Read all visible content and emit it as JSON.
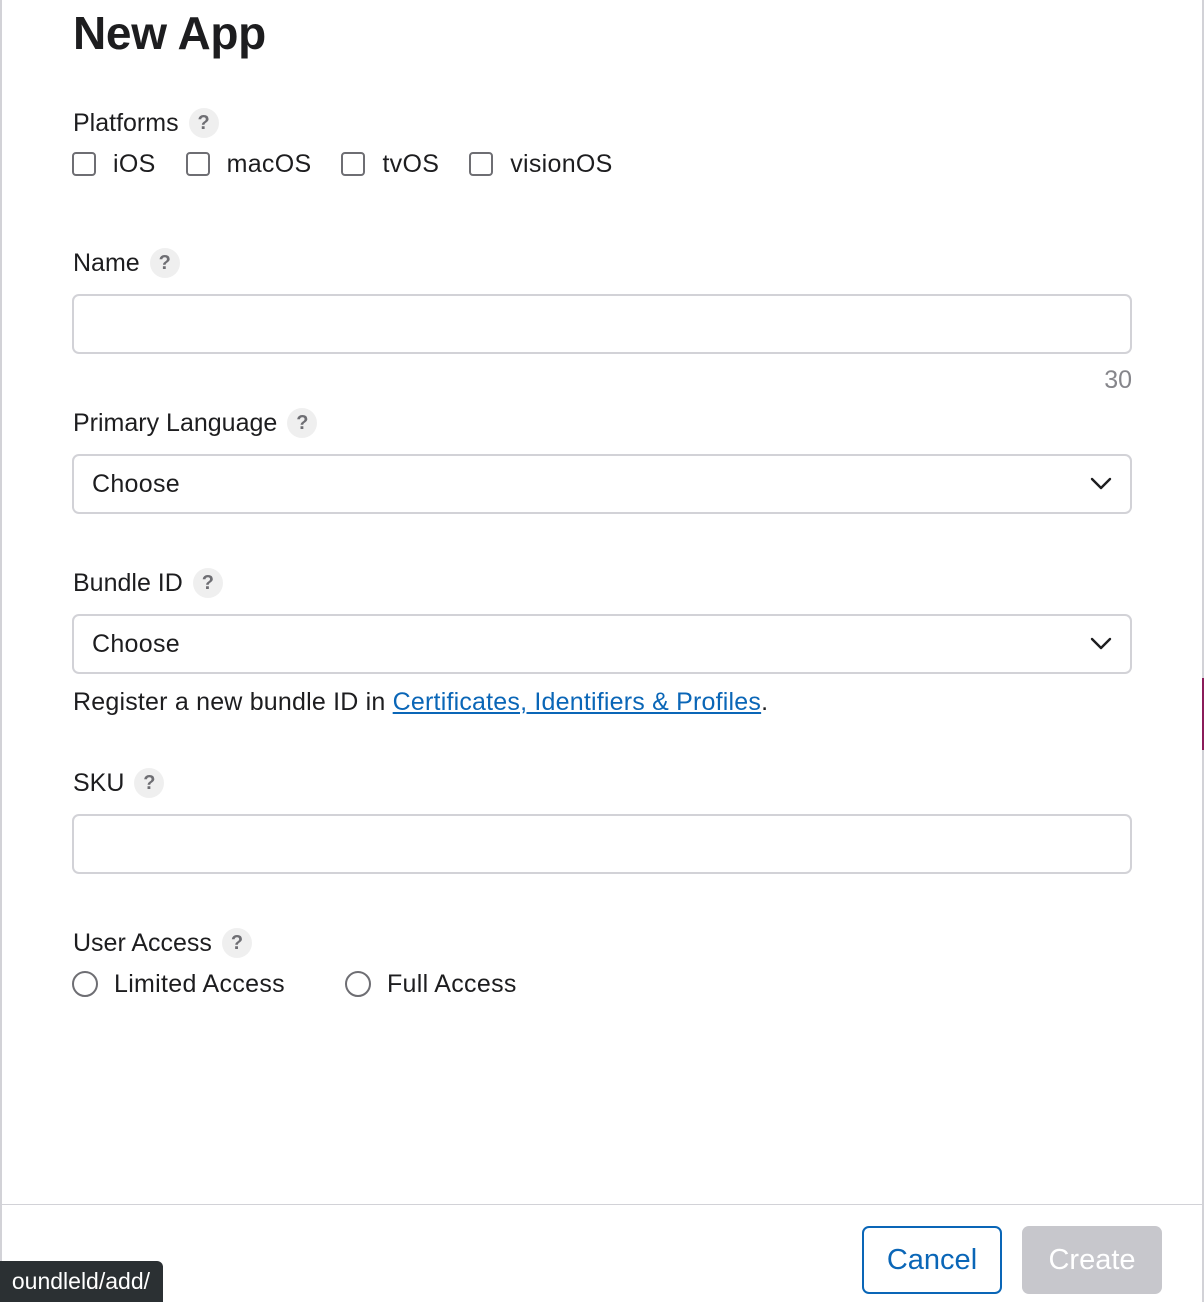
{
  "modal": {
    "title": "New App"
  },
  "platforms": {
    "label": "Platforms",
    "options": [
      "iOS",
      "macOS",
      "tvOS",
      "visionOS"
    ]
  },
  "name_field": {
    "label": "Name",
    "value": "",
    "char_remaining": "30"
  },
  "primary_language": {
    "label": "Primary Language",
    "selected": "Choose"
  },
  "bundle_id": {
    "label": "Bundle ID",
    "selected": "Choose",
    "helper_prefix": "Register a new bundle ID in ",
    "helper_link": "Certificates, Identifiers & Profiles",
    "helper_suffix": "."
  },
  "sku": {
    "label": "SKU",
    "value": ""
  },
  "user_access": {
    "label": "User Access",
    "options": [
      "Limited Access",
      "Full Access"
    ]
  },
  "footer": {
    "cancel_label": "Cancel",
    "create_label": "Create"
  },
  "status_url": "oundleld/add/",
  "help_glyph": "?",
  "colors": {
    "accent": "#0a66b7",
    "disabled_button": "#c7c7cc",
    "border": "#d2d2d7"
  }
}
